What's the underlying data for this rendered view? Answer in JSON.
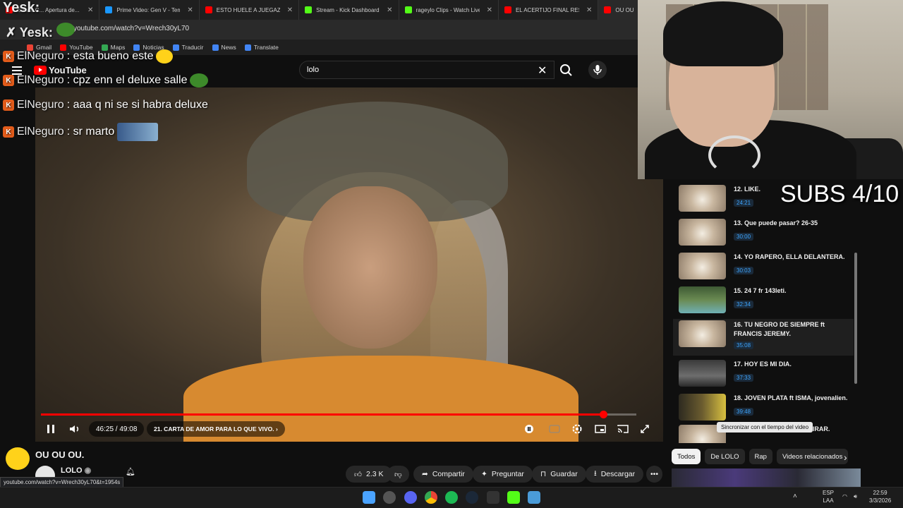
{
  "browser": {
    "tabs": [
      {
        "label": "E-man C... Apertura de...",
        "color": "#ff0000",
        "active": false
      },
      {
        "label": "Prime Video: Gen V - Tem",
        "color": "#1a98ff",
        "active": false
      },
      {
        "label": "ESTO HUELE A JUEGAZO",
        "color": "#ff0000",
        "active": false
      },
      {
        "label": "Stream - Kick Dashboard",
        "color": "#53fc18",
        "active": false
      },
      {
        "label": "rageylo Clips - Watch Live",
        "color": "#53fc18",
        "active": false
      },
      {
        "label": "EL ACERTIJO FINAL RESUE",
        "color": "#ff0000",
        "active": false
      },
      {
        "label": "OU OU",
        "color": "#ff0000",
        "active": true
      }
    ],
    "url": "youtube.com/watch?v=Wrech30yL70",
    "bookmarks": [
      {
        "label": "Gmail",
        "color": "#ea4335"
      },
      {
        "label": "YouTube",
        "color": "#ff0000"
      },
      {
        "label": "Maps",
        "color": "#34a853"
      },
      {
        "label": "Noticias",
        "color": "#4285f4"
      },
      {
        "label": "Traducir",
        "color": "#4285f4"
      },
      {
        "label": "News",
        "color": "#4285f4"
      },
      {
        "label": "Translate",
        "color": "#4285f4"
      }
    ],
    "status_url": "youtube.com/watch?v=Wrech30yL70&t=1954s"
  },
  "overlay": {
    "brand": "Yesk:",
    "chat": [
      {
        "user": "ElNeguro",
        "text": ": esta bueno este"
      },
      {
        "user": "ElNeguro",
        "text": ": cpz enn el deluxe salle"
      },
      {
        "user": "ElNeguro",
        "text": ": aaa q ni se si habra deluxe"
      },
      {
        "user": "ElNeguro",
        "text": ": sr marto"
      }
    ],
    "subs_counter": "SUBS 4/10"
  },
  "youtube": {
    "logo": "YouTube",
    "search_value": "lolo",
    "player": {
      "time": "46:25 / 49:08",
      "chapter": "21. CARTA DE AMOR PARA LO QUE VIVO.",
      "progress": 0.9447
    },
    "video_title": "OU OU OU.",
    "channel": "LOLO",
    "actions": {
      "likes": "2.3 K",
      "share": "Compartir",
      "ask": "Preguntar",
      "save": "Guardar",
      "download": "Descargar"
    },
    "playlist": [
      {
        "title": "12. LIKE.",
        "duration": "24:21",
        "thumb": "logo"
      },
      {
        "title": "13. Que puede pasar? 26-35",
        "duration": "30:00",
        "thumb": "logo"
      },
      {
        "title": "14. YO RAPERO, ELLA DELANTERA.",
        "duration": "30:03",
        "thumb": "logo"
      },
      {
        "title": "15. 24 7 fr 143leti.",
        "duration": "32:34",
        "thumb": "photo"
      },
      {
        "title": "16. TU NEGRO DE SIEMPRE ft FRANCIS JEREMY.",
        "duration": "35:08",
        "thumb": "logo"
      },
      {
        "title": "17. HOY ES MI DIA.",
        "duration": "37:33",
        "thumb": "dark"
      },
      {
        "title": "18. JOVEN PLATA ft ISMA, jovenalien.",
        "duration": "39:48",
        "thumb": "yellow"
      },
      {
        "title": "19. ROBEMOS CON M A GIRAR.",
        "duration": "",
        "thumb": "logo"
      }
    ],
    "tooltip": "Sincronizar con el tiempo del video",
    "chips": [
      "Todos",
      "De LOLO",
      "Rap",
      "Videos relacionados"
    ]
  },
  "taskbar": {
    "lang_top": "ESP",
    "lang_bottom": "LAA",
    "time": "22:59",
    "date": "3/3/2026"
  }
}
